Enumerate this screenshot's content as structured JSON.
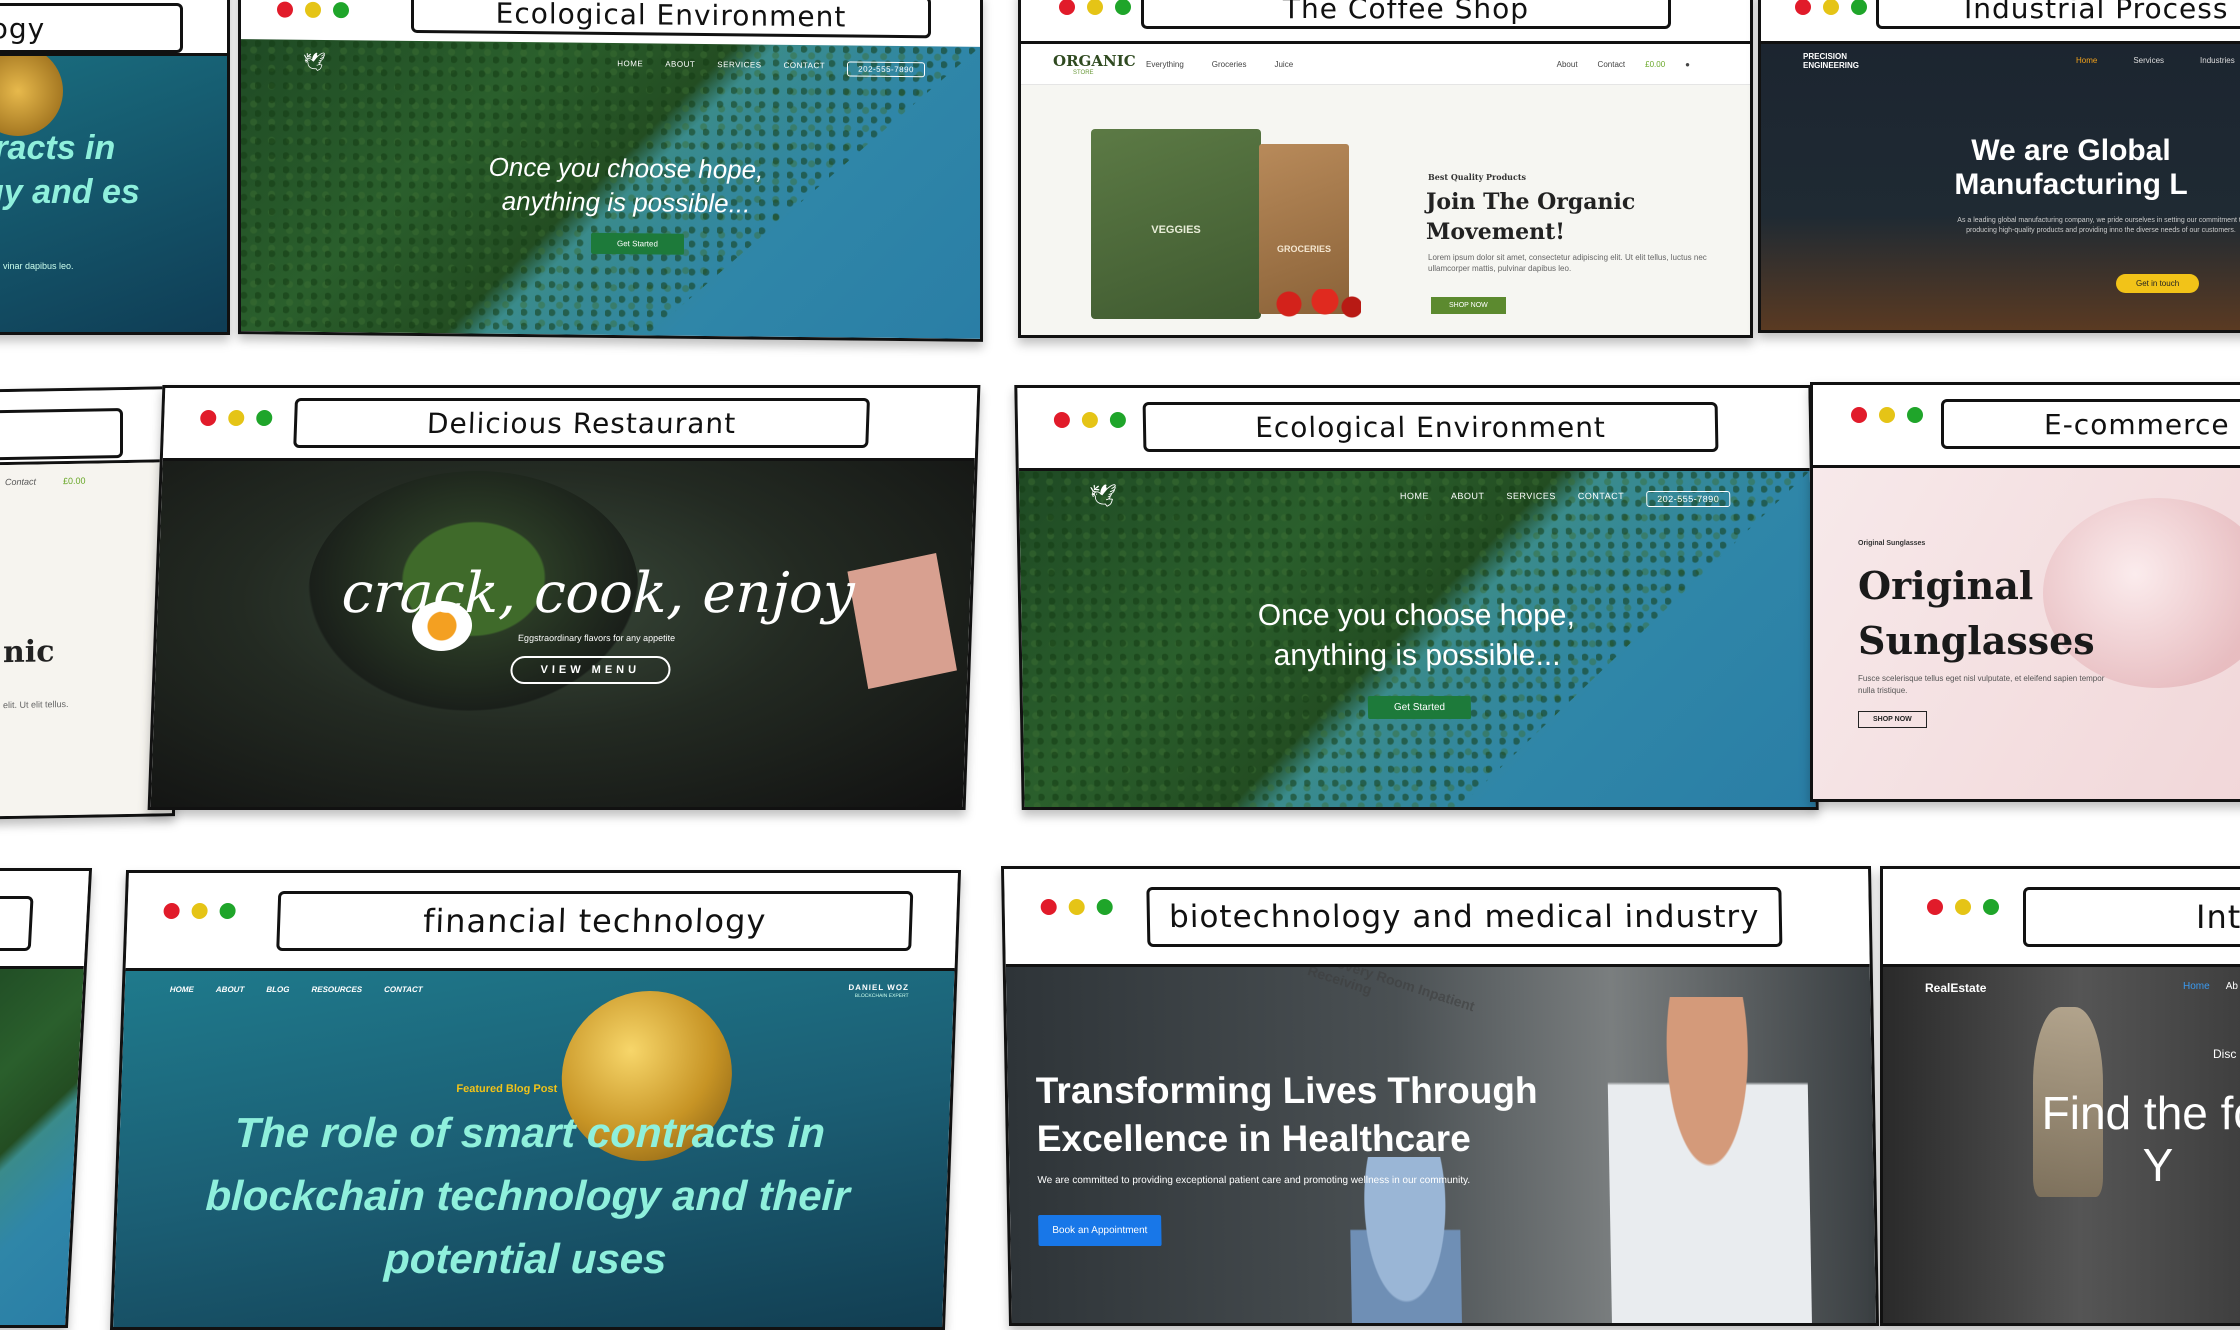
{
  "cards": {
    "eco_top": {
      "title": "Ecological Environment",
      "nav": [
        "HOME",
        "ABOUT",
        "SERVICES",
        "CONTACT"
      ],
      "phone": "202-555-7890",
      "headline": "Once you choose hope, anything is possible...",
      "cta": "Get Started"
    },
    "coffee": {
      "title": "The Coffee Shop",
      "logo": "ORGANIC",
      "logo_sub": "STORE",
      "nav_left": [
        "Everything",
        "Groceries",
        "Juice"
      ],
      "nav_right": [
        "About",
        "Contact"
      ],
      "cart": "£0.00",
      "kicker": "Best Quality Products",
      "headline": "Join The Organic Movement!",
      "body": "Lorem ipsum dolor sit amet, consectetur adipiscing elit. Ut elit tellus, luctus nec ullamcorper mattis, pulvinar dapibus leo.",
      "cta": "SHOP NOW",
      "bag1": "VEGGIES",
      "bag2": "GROCERIES"
    },
    "industrial": {
      "title": "Industrial Process",
      "logo": "PRECISION ENGINEERING",
      "nav": [
        "Home",
        "Services",
        "Industries"
      ],
      "headline": "We are Global Manufacturing L",
      "body": "As a leading global manufacturing company, we pride ourselves in setting our commitment to producing high-quality products and providing inno the diverse needs of our customers.",
      "cta": "Get in touch"
    },
    "left_top": {
      "title": "logy",
      "headline": "tracts in gy and es",
      "small": "vinar dapibus leo."
    },
    "restaurant": {
      "title": "Delicious Restaurant",
      "headline": "crack, cook, enjoy",
      "sub": "Eggstraordinary flavors for any appetite",
      "cta": "VIEW MENU"
    },
    "eco_mid": {
      "title": "Ecological Environment",
      "nav": [
        "HOME",
        "ABOUT",
        "SERVICES",
        "CONTACT"
      ],
      "phone": "202-555-7890",
      "headline": "Once you choose hope, anything is possible...",
      "cta": "Get Started"
    },
    "ecommerce": {
      "title": "E-commerce",
      "kicker": "Original Sunglasses",
      "headline": "Original Sunglasses",
      "body": "Fusce scelerisque tellus eget nisl vulputate, et eleifend sapien tempor nulla tristique.",
      "cta": "SHOP NOW"
    },
    "left_mid": {
      "contact": "Contact",
      "cart": "£0.00",
      "headline": "nic",
      "small": "elit. Ut elit tellus."
    },
    "fintech": {
      "title": "financial technology",
      "nav": [
        "HOME",
        "ABOUT",
        "BLOG",
        "RESOURCES",
        "CONTACT"
      ],
      "brand": "DANIEL WOZ",
      "brand_sub": "BLOCKCHAIN EXPERT",
      "kicker": "Featured Blog Post",
      "headline": "The role of smart contracts in blockchain technology and their potential uses"
    },
    "biotech": {
      "title": "biotechnology and medical industry",
      "headline": "Transforming Lives Through Excellence in Healthcare",
      "body": "We are committed to providing exceptional patient care and promoting wellness in our community.",
      "cta": "Book an Appointment",
      "sign": "Recovery Room Inpatient Receiving"
    },
    "realestate": {
      "title": "Inte",
      "logo": "RealEstate",
      "nav": [
        "Home",
        "Ab"
      ],
      "kicker": "Disc",
      "headline": "Find the for Y"
    }
  },
  "colors": {
    "ink": "#111111",
    "green": "#1d7a3a",
    "yellow": "#f2c318",
    "blue": "#1877e8",
    "teal_text": "#8ff0dc"
  }
}
